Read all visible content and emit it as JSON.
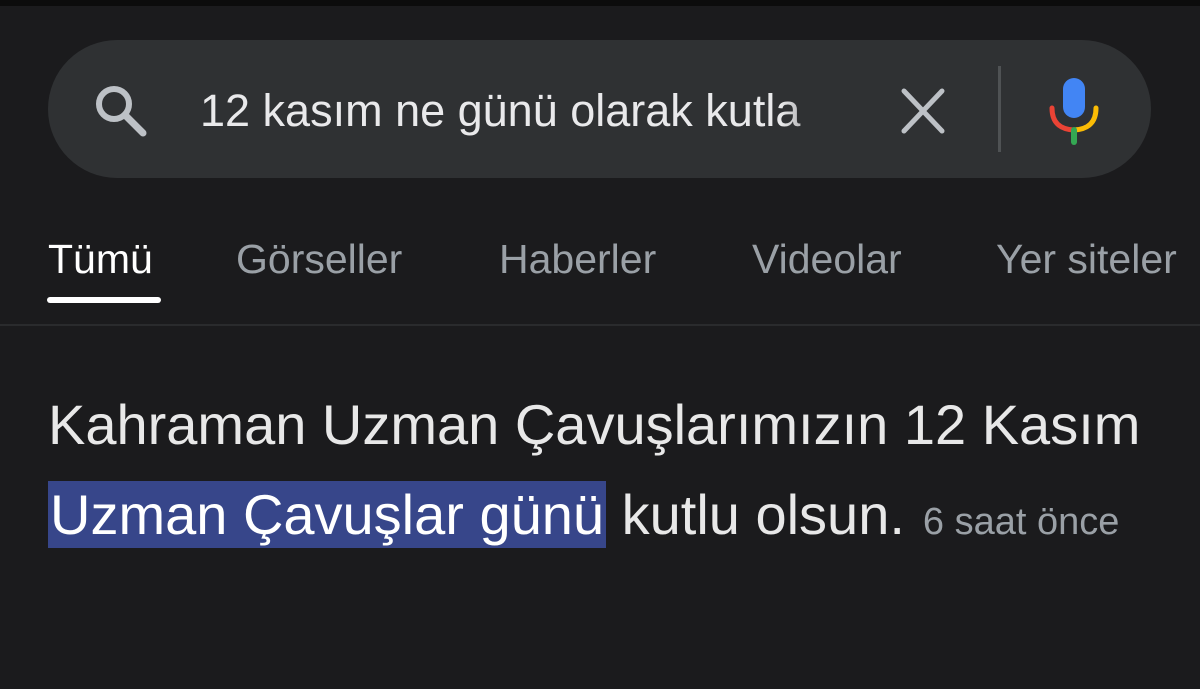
{
  "search": {
    "query": "12 kasım ne günü olarak kutla",
    "icon": "search-icon",
    "clear_icon": "close-icon",
    "mic_icon": "mic-icon"
  },
  "tabs": [
    {
      "label": "Tümü",
      "active": true
    },
    {
      "label": "Görseller",
      "active": false
    },
    {
      "label": "Haberler",
      "active": false
    },
    {
      "label": "Videolar",
      "active": false
    },
    {
      "label": "Yer siteler",
      "active": false
    }
  ],
  "result": {
    "text_before": "Kahraman Uzman Çavuşlarımızın 12 Kasım",
    "highlighted": "Uzman Çavuşlar günü",
    "text_after": "kutlu olsun.",
    "time": "6 saat önce"
  },
  "colors": {
    "background": "#1b1b1d",
    "search_bg": "#2f3133",
    "highlight": "#37468a",
    "mic_blue": "#4285f4",
    "mic_red": "#ea4335",
    "mic_yellow": "#fbbc05",
    "mic_green": "#34a853"
  }
}
